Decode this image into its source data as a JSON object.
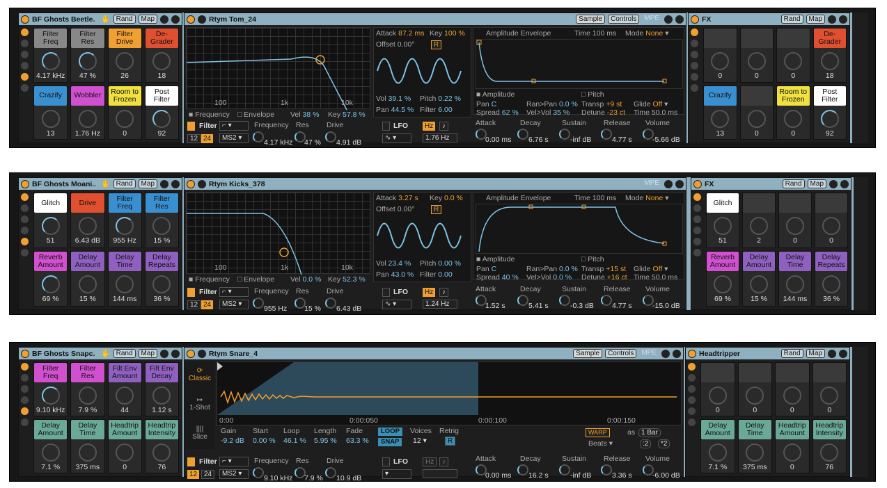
{
  "racks": [
    {
      "rack_title": "BF Ghosts Beetle...",
      "rand": "Rand",
      "map": "Map",
      "macros": [
        {
          "label": "Filter\nFreq",
          "value": "4.17 kHz",
          "color": "#888888"
        },
        {
          "label": "Filter\nRes",
          "value": "47 %",
          "color": "#888888"
        },
        {
          "label": "Filter\nDrive",
          "value": "26",
          "color": "#f0a030"
        },
        {
          "label": "De-\nGrader",
          "value": "18",
          "color": "#e05030"
        },
        {
          "label": "Crazify",
          "value": "13",
          "color": "#3a8fd0"
        },
        {
          "label": "Wobbler",
          "value": "1.76 Hz",
          "color": "#d050d0"
        },
        {
          "label": "Room to\nFrozen",
          "value": "0",
          "color": "#f0e040"
        },
        {
          "label": "Post\nFilter",
          "value": "92",
          "color": "#ffffff"
        }
      ],
      "sim_title": "Rtym Tom_24",
      "sim_tabs": [
        "Sample",
        "Controls",
        "MPE"
      ],
      "filter_labels": [
        "100",
        "1k",
        "10k"
      ],
      "freq_legend": "Frequency",
      "env_legend": "Envelope",
      "vel": "Vel",
      "vel_val": "38 %",
      "key": "Key",
      "key_val": "57.8 %",
      "filter_name": "Filter",
      "slope_12": "12",
      "slope_24": "24",
      "ms2": "MS2",
      "frequency": "Frequency",
      "freq_val": "4.17 kHz",
      "res": "Res",
      "res_val": "47 %",
      "drive": "Drive",
      "drive_val": "4.91 dB",
      "attack": "Attack",
      "attack_val": "87.2 ms",
      "lkey": "Key",
      "lkey_val": "100 %",
      "offset": "Offset",
      "offset_val": "0.00°",
      "r": "R",
      "lvol": "Vol",
      "lvol_val": "39.1 %",
      "pitch": "Pitch",
      "pitch_val": "0.22 %",
      "pan": "Pan",
      "pan_val": "44.5 %",
      "lfilter": "Filter",
      "lfilter_val": "6.00",
      "lfo": "LFO",
      "hz": "Hz",
      "note": "♪",
      "lfo_rate": "1.76 Hz",
      "amp_env": "Amplitude Envelope",
      "time": "Time",
      "time_val": "100 ms",
      "mode": "Mode",
      "mode_val": "None",
      "amplitude": "Amplitude",
      "ppitch": "Pitch",
      "epan": "Pan",
      "epan_val": "C",
      "ranpan": "Ran>Pan",
      "ranpan_val": "0.0 %",
      "transp": "Transp",
      "transp_val": "+9 st",
      "glide": "Glide",
      "glide_val": "Off",
      "spread": "Spread",
      "spread_val": "62 %",
      "velvol": "Vel>Vol",
      "velvol_val": "35 %",
      "detune": "Detune",
      "detune_val": "-23 ct",
      "etime": "Time",
      "etime_val": "50.0 ms",
      "adsr": [
        {
          "l": "Attack",
          "v": "0.00 ms"
        },
        {
          "l": "Decay",
          "v": "6.76 s"
        },
        {
          "l": "Sustain",
          "v": "-inf dB"
        },
        {
          "l": "Release",
          "v": "4.77 s"
        },
        {
          "l": "Volume",
          "v": "-5.66 dB"
        }
      ],
      "fx_title": "FX",
      "fx_macros": [
        {
          "label": "",
          "value": "0",
          "color": ""
        },
        {
          "label": "",
          "value": "0",
          "color": ""
        },
        {
          "label": "",
          "value": "0",
          "color": ""
        },
        {
          "label": "De-\nGrader",
          "value": "18",
          "color": "#e05030"
        },
        {
          "label": "Crazify",
          "value": "13",
          "color": "#3a8fd0"
        },
        {
          "label": "",
          "value": "0",
          "color": ""
        },
        {
          "label": "Room to\nFrozen",
          "value": "0",
          "color": "#f0e040"
        },
        {
          "label": "Post\nFilter",
          "value": "92",
          "color": "#ffffff"
        }
      ]
    },
    {
      "rack_title": "BF Ghosts Moani...",
      "rand": "Rand",
      "map": "Map",
      "macros": [
        {
          "label": "Glitch",
          "value": "51",
          "color": "#ffffff"
        },
        {
          "label": "Drive",
          "value": "6.43 dB",
          "color": "#e05030"
        },
        {
          "label": "Filter\nFreq",
          "value": "955 Hz",
          "color": "#3a8fd0"
        },
        {
          "label": "Filter\nRes",
          "value": "15 %",
          "color": "#3a8fd0"
        },
        {
          "label": "Reverb\nAmount",
          "value": "69 %",
          "color": "#d050d0"
        },
        {
          "label": "Delay\nAmount",
          "value": "15 %",
          "color": "#9060c0"
        },
        {
          "label": "Delay\nTime",
          "value": "144 ms",
          "color": "#9060c0"
        },
        {
          "label": "Delay\nRepeats",
          "value": "36 %",
          "color": "#9060c0"
        }
      ],
      "sim_title": "Rtym Kicks_378",
      "sim_tabs": [
        "",
        "",
        "MPE"
      ],
      "filter_labels": [
        "100",
        "1k",
        "10k"
      ],
      "freq_legend": "Frequency",
      "env_legend": "Envelope",
      "vel": "Vel",
      "vel_val": "0.0 %",
      "key": "Key",
      "key_val": "52.3 %",
      "filter_name": "Filter",
      "slope_12": "12",
      "slope_24": "24",
      "ms2": "MS2",
      "frequency": "Frequency",
      "freq_val": "955 Hz",
      "res": "Res",
      "res_val": "15 %",
      "drive": "Drive",
      "drive_val": "6.43 dB",
      "attack": "Attack",
      "attack_val": "3.27 s",
      "lkey": "Key",
      "lkey_val": "0.0 %",
      "offset": "Offset",
      "offset_val": "0.00°",
      "r": "R",
      "lvol": "Vol",
      "lvol_val": "23.4 %",
      "pitch": "Pitch",
      "pitch_val": "0.00 %",
      "pan": "Pan",
      "pan_val": "43.0 %",
      "lfilter": "Filter",
      "lfilter_val": "0.00",
      "lfo": "LFO",
      "hz": "Hz",
      "note": "♪",
      "lfo_rate": "1.24 Hz",
      "amp_env": "Amplitude Envelope",
      "time": "Time",
      "time_val": "100 ms",
      "mode": "Mode",
      "mode_val": "None",
      "amplitude": "Amplitude",
      "ppitch": "Pitch",
      "epan": "Pan",
      "epan_val": "C",
      "ranpan": "Ran>Pan",
      "ranpan_val": "0.0 %",
      "transp": "Transp",
      "transp_val": "+15 st",
      "glide": "Glide",
      "glide_val": "Off",
      "spread": "Spread",
      "spread_val": "40 %",
      "velvol": "Vel>Vol",
      "velvol_val": "0.0 %",
      "detune": "Detune",
      "detune_val": "+16 ct",
      "etime": "Time",
      "etime_val": "50.0 ms",
      "adsr": [
        {
          "l": "Attack",
          "v": "1.52 s"
        },
        {
          "l": "Decay",
          "v": "5.41 s"
        },
        {
          "l": "Sustain",
          "v": "-0.3 dB"
        },
        {
          "l": "Release",
          "v": "4.77 s"
        },
        {
          "l": "Volume",
          "v": "-15.0 dB"
        }
      ],
      "fx_title": "FX",
      "fx_macros": [
        {
          "label": "Glitch",
          "value": "51",
          "color": "#ffffff"
        },
        {
          "label": "",
          "value": "2",
          "color": ""
        },
        {
          "label": "",
          "value": "0",
          "color": ""
        },
        {
          "label": "",
          "value": "0",
          "color": ""
        },
        {
          "label": "Reverb\nAmount",
          "value": "69 %",
          "color": "#d050d0"
        },
        {
          "label": "Delay\nAmount",
          "value": "15 %",
          "color": "#9060c0"
        },
        {
          "label": "Delay\nTime",
          "value": "144 ms",
          "color": "#9060c0"
        },
        {
          "label": "Delay\nRepeats",
          "value": "36 %",
          "color": "#9060c0"
        }
      ]
    },
    {
      "rack_title": "BF Ghosts Snapc...",
      "rand": "Rand",
      "map": "Map",
      "macros": [
        {
          "label": "Filter\nFreq",
          "value": "9.10 kHz",
          "color": "#d050d0"
        },
        {
          "label": "Filter\nRes",
          "value": "7.9 %",
          "color": "#d050d0"
        },
        {
          "label": "Filt Env\nAmount",
          "value": "44",
          "color": "#9060c0"
        },
        {
          "label": "Filt Env\nDecay",
          "value": "1.12 s",
          "color": "#9060c0"
        },
        {
          "label": "Delay\nAmount",
          "value": "7.1 %",
          "color": "#6aa898"
        },
        {
          "label": "Delay\nTime",
          "value": "375 ms",
          "color": "#6aa898"
        },
        {
          "label": "Headtrip\nAmount",
          "value": "0",
          "color": "#6aa898"
        },
        {
          "label": "Headtrip\nIntensity",
          "value": "76",
          "color": "#6aa898"
        }
      ],
      "sim_title": "Rtym Snare_4",
      "sim_tabs": [
        "Sample",
        "Controls",
        "MPE"
      ],
      "modes": [
        "Classic",
        "1-Shot",
        "Slice"
      ],
      "time_ticks": [
        "0:00",
        "0:00:050",
        "0:00:100",
        "0:00:150"
      ],
      "gain": "Gain",
      "gain_val": "-9.2 dB",
      "start": "Start",
      "start_val": "0.00 %",
      "loop": "Loop",
      "loop_val": "46.1 %",
      "length": "Length",
      "length_val": "5.95 %",
      "fade": "Fade",
      "fade_val": "63.3 %",
      "loop_btn": "LOOP",
      "snap_btn": "SNAP",
      "voices": "Voices",
      "voices_val": "12",
      "retrig": "Retrig",
      "r": "R",
      "warp": "WARP",
      "as": "as",
      "bars": "1 Bar",
      "beats": "Beats",
      "div2": ":2",
      "mul2": "*2",
      "filter_name": "Filter",
      "slope_12": "12",
      "slope_24": "24",
      "ms2": "MS2",
      "frequency": "Frequency",
      "freq_val": "9.10 kHz",
      "res": "Res",
      "res_val": "7.9 %",
      "drive": "Drive",
      "drive_val": "10.9 dB",
      "lfo": "LFO",
      "hz": "Hz",
      "note": "♪",
      "adsr": [
        {
          "l": "Attack",
          "v": "0.00 ms"
        },
        {
          "l": "Decay",
          "v": "16.2 s"
        },
        {
          "l": "Sustain",
          "v": "-inf dB"
        },
        {
          "l": "Release",
          "v": "3.36 s"
        },
        {
          "l": "Volume",
          "v": "-6.00 dB"
        }
      ],
      "fx_title": "Headtripper",
      "fx_macros": [
        {
          "label": "",
          "value": "0",
          "color": ""
        },
        {
          "label": "",
          "value": "0",
          "color": ""
        },
        {
          "label": "",
          "value": "0",
          "color": ""
        },
        {
          "label": "",
          "value": "0",
          "color": ""
        },
        {
          "label": "Delay\nAmount",
          "value": "7.1 %",
          "color": "#6aa898"
        },
        {
          "label": "Delay\nTime",
          "value": "375 ms",
          "color": "#6aa898"
        },
        {
          "label": "Headtrip\nAmount",
          "value": "0",
          "color": "#6aa898"
        },
        {
          "label": "Headtrip\nIntensity",
          "value": "76",
          "color": "#6aa898"
        }
      ]
    }
  ]
}
